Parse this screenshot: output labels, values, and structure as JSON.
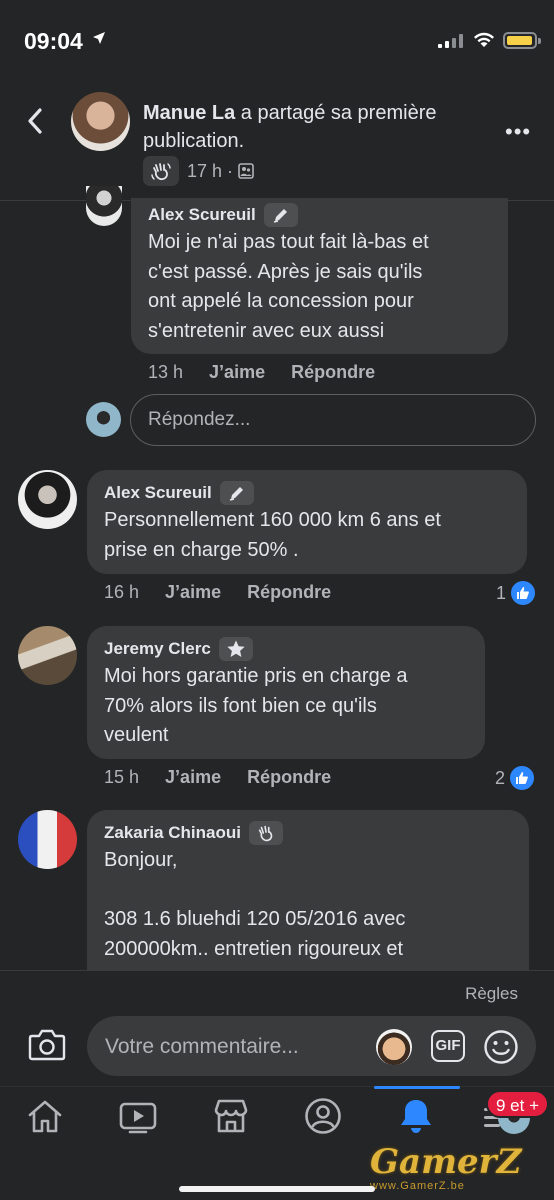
{
  "status_bar": {
    "time": "09:04"
  },
  "header": {
    "author": "Manue La",
    "action_text": " a partagé sa première publication.",
    "timestamp": "17 h",
    "separator": "·"
  },
  "comments": [
    {
      "author": "Alex Scureuil",
      "badge": "pen-icon",
      "text": "Moi je n'ai pas tout fait là-bas et\nc'est passé. Après je sais qu'ils\nont appelé la concession pour\ns'entretenir avec eux aussi",
      "time": "13 h",
      "like_label": "J’aime",
      "reply_label": "Répondre"
    },
    {
      "author": "Alex Scureuil",
      "badge": "pen-icon",
      "text": "Personnellement 160 000 km 6 ans et\nprise en charge 50% .",
      "time": "16 h",
      "like_label": "J’aime",
      "reply_label": "Répondre",
      "likes": "1"
    },
    {
      "author": "Jeremy Clerc",
      "badge": "star-icon",
      "text": "Moi hors garantie pris en charge a\n70% alors ils font bien ce qu'ils\nveulent",
      "time": "15 h",
      "like_label": "J’aime",
      "reply_label": "Répondre",
      "likes": "2"
    },
    {
      "author": "Zakaria Chinaoui",
      "badge": "wave-icon",
      "text": "Bonjour,\n\n308 1.6 bluehdi 120 05/2016 avec\n200000km.. entretien rigoureux et"
    }
  ],
  "reply_input": {
    "placeholder": "Répondez..."
  },
  "composer": {
    "rules_label": "Règles",
    "placeholder": "Votre commentaire...",
    "gif_label": "GIF"
  },
  "tabbar": {
    "tabs": [
      "home-icon",
      "video-icon",
      "marketplace-icon",
      "profile-icon",
      "notifications-icon",
      "menu-icon"
    ],
    "badge": "9 et +"
  },
  "watermark": {
    "text": "GamerZ",
    "sub": "www.GamerZ.be"
  },
  "colors": {
    "background": "#242526",
    "bubble": "#3a3b3c",
    "accent": "#2d88ff",
    "badge_red": "#e41e3f"
  }
}
